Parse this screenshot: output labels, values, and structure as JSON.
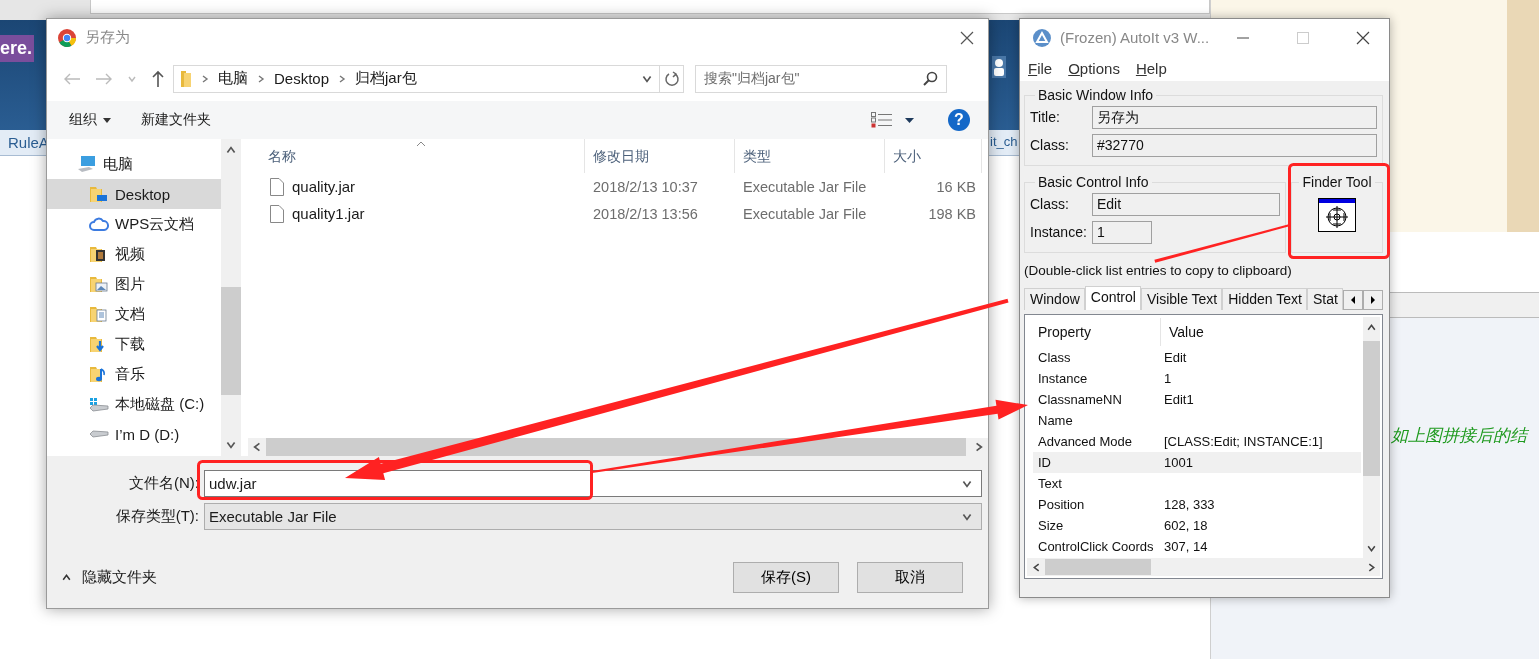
{
  "browser": {
    "badge": "ere.",
    "tab_bar_texts": [
      "RuleA",
      "it_ch"
    ]
  },
  "save_dialog": {
    "title": "另存为",
    "breadcrumb": [
      "电脑",
      "Desktop",
      "归档jar包"
    ],
    "search": {
      "placeholder": "搜索\"归档jar包\""
    },
    "toolbar": {
      "organize": "组织",
      "new_folder": "新建文件夹",
      "help": "?"
    },
    "nav": [
      {
        "label": "电脑",
        "kind": "computer",
        "selected": false,
        "children": [
          {
            "label": "Desktop",
            "kind": "desktop",
            "selected": true
          },
          {
            "label": "WPS云文档",
            "kind": "cloud",
            "selected": false
          },
          {
            "label": "视频",
            "kind": "videos",
            "selected": false
          },
          {
            "label": "图片",
            "kind": "pictures",
            "selected": false
          },
          {
            "label": "文档",
            "kind": "documents",
            "selected": false
          },
          {
            "label": "下载",
            "kind": "downloads",
            "selected": false
          },
          {
            "label": "音乐",
            "kind": "music",
            "selected": false
          },
          {
            "label": "本地磁盘 (C:)",
            "kind": "system_drive",
            "selected": false
          },
          {
            "label": "I’m D (D:)",
            "kind": "drive",
            "selected": false
          }
        ]
      }
    ],
    "columns": [
      "名称",
      "修改日期",
      "类型",
      "大小"
    ],
    "files": [
      {
        "name": "quality.jar",
        "modified": "2018/2/13 10:37",
        "type": "Executable Jar File",
        "size": "16 KB"
      },
      {
        "name": "quality1.jar",
        "modified": "2018/2/13 13:56",
        "type": "Executable Jar File",
        "size": "198 KB"
      }
    ],
    "file_name": {
      "label": "文件名(N):",
      "value": "udw.jar"
    },
    "file_type": {
      "label": "保存类型(T):",
      "value": "Executable Jar File"
    },
    "hide_folders": "隐藏文件夹",
    "buttons": [
      "保存(S)",
      "取消"
    ]
  },
  "autoit_window": {
    "title": "(Frozen) AutoIt v3 W...",
    "menu": [
      "File",
      "Options",
      "Help"
    ],
    "basic_window_info": {
      "title": "Basic Window Info",
      "fields": [
        {
          "label": "Title:",
          "value": "另存为"
        },
        {
          "label": "Class:",
          "value": "#32770"
        }
      ]
    },
    "basic_control_info": {
      "title": "Basic Control Info",
      "fields": [
        {
          "label": "Class:",
          "value": "Edit"
        },
        {
          "label": "Instance:",
          "value": "1"
        }
      ]
    },
    "finder_tool": {
      "title": "Finder Tool"
    },
    "hint": "(Double-click list entries to copy to clipboard)",
    "tabs": [
      {
        "label": "Window",
        "selected": false
      },
      {
        "label": "Control",
        "selected": true
      },
      {
        "label": "Visible Text",
        "selected": false
      },
      {
        "label": "Hidden Text",
        "selected": false
      },
      {
        "label": "Stat",
        "selected": false
      }
    ],
    "table": {
      "columns": [
        "Property",
        "Value"
      ],
      "rows": [
        {
          "property": "Class",
          "value": "Edit",
          "selected": false
        },
        {
          "property": "Instance",
          "value": "1",
          "selected": false
        },
        {
          "property": "ClassnameNN",
          "value": "Edit1",
          "selected": false
        },
        {
          "property": "Name",
          "selected": false
        },
        {
          "property": "Advanced Mode",
          "value": "[CLASS:Edit; INSTANCE:1]",
          "selected": false
        },
        {
          "property": "ID",
          "value": "1001",
          "selected": true
        },
        {
          "property": "Text",
          "selected": false
        },
        {
          "property": "Position",
          "value": "128, 333",
          "selected": false
        },
        {
          "property": "Size",
          "value": "602, 18",
          "selected": false
        },
        {
          "property": "ControlClick Coords",
          "value": "307, 14",
          "selected": false
        }
      ]
    }
  },
  "document": {
    "note": "如上图拼接后的结"
  }
}
